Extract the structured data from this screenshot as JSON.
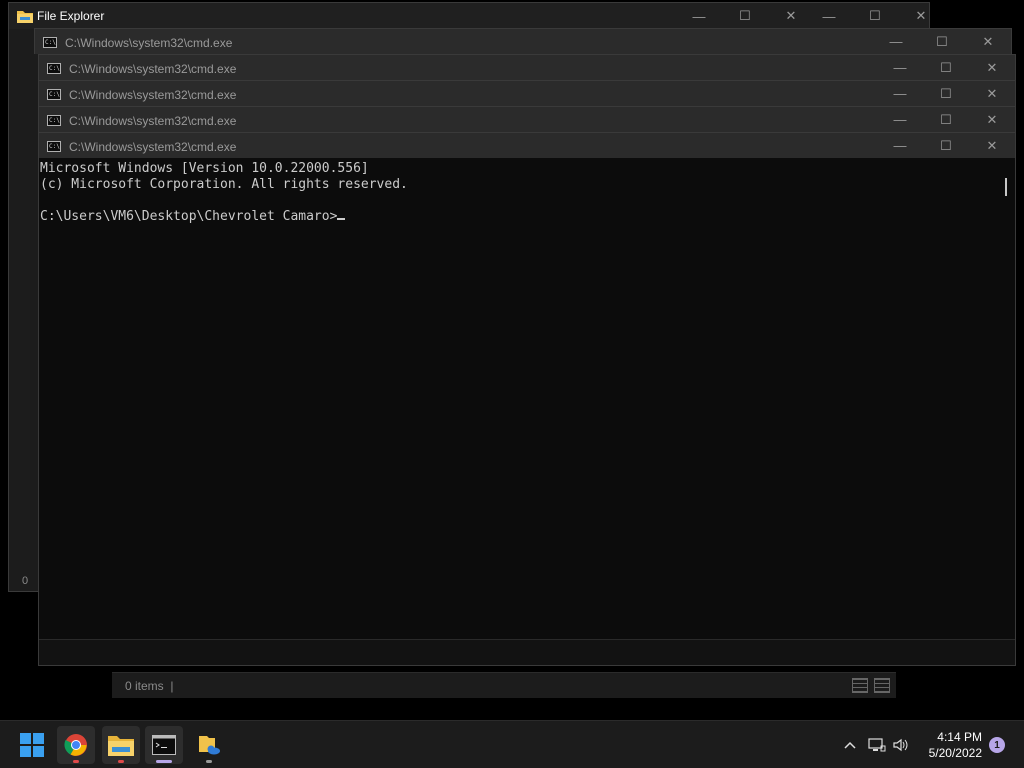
{
  "file_explorer": {
    "title": "File Explorer",
    "status_items": "0 items",
    "status_separator": "|",
    "count_label": "0"
  },
  "cmd_windows": [
    {
      "title": "C:\\Windows\\system32\\cmd.exe"
    },
    {
      "title": "C:\\Windows\\system32\\cmd.exe"
    },
    {
      "title": "C:\\Windows\\system32\\cmd.exe"
    },
    {
      "title": "C:\\Windows\\system32\\cmd.exe"
    },
    {
      "title": "C:\\Windows\\system32\\cmd.exe"
    }
  ],
  "console": {
    "line1": "Microsoft Windows [Version 10.0.22000.556]",
    "line2": "(c) Microsoft Corporation. All rights reserved.",
    "prompt": "C:\\Users\\VM6\\Desktop\\Chevrolet Camaro>"
  },
  "window_controls": {
    "minimize": "—",
    "maximize": "☐",
    "close": "✕"
  },
  "taskbar": {
    "apps": [
      {
        "name": "start-button",
        "icon": "windows-logo-icon"
      },
      {
        "name": "chrome-button",
        "icon": "chrome-icon"
      },
      {
        "name": "file-explorer-button",
        "icon": "folder-icon"
      },
      {
        "name": "cmd-button",
        "icon": "cmd-icon"
      },
      {
        "name": "onedrive-folder-button",
        "icon": "onedrive-icon"
      }
    ],
    "time": "4:14 PM",
    "date": "5/20/2022",
    "notification_count": "1"
  },
  "colors": {
    "accent": "#b7a6e8",
    "console_bg": "#0c0c0c",
    "console_fg": "#cccccc",
    "taskbar_bg": "#1c1c1c"
  }
}
